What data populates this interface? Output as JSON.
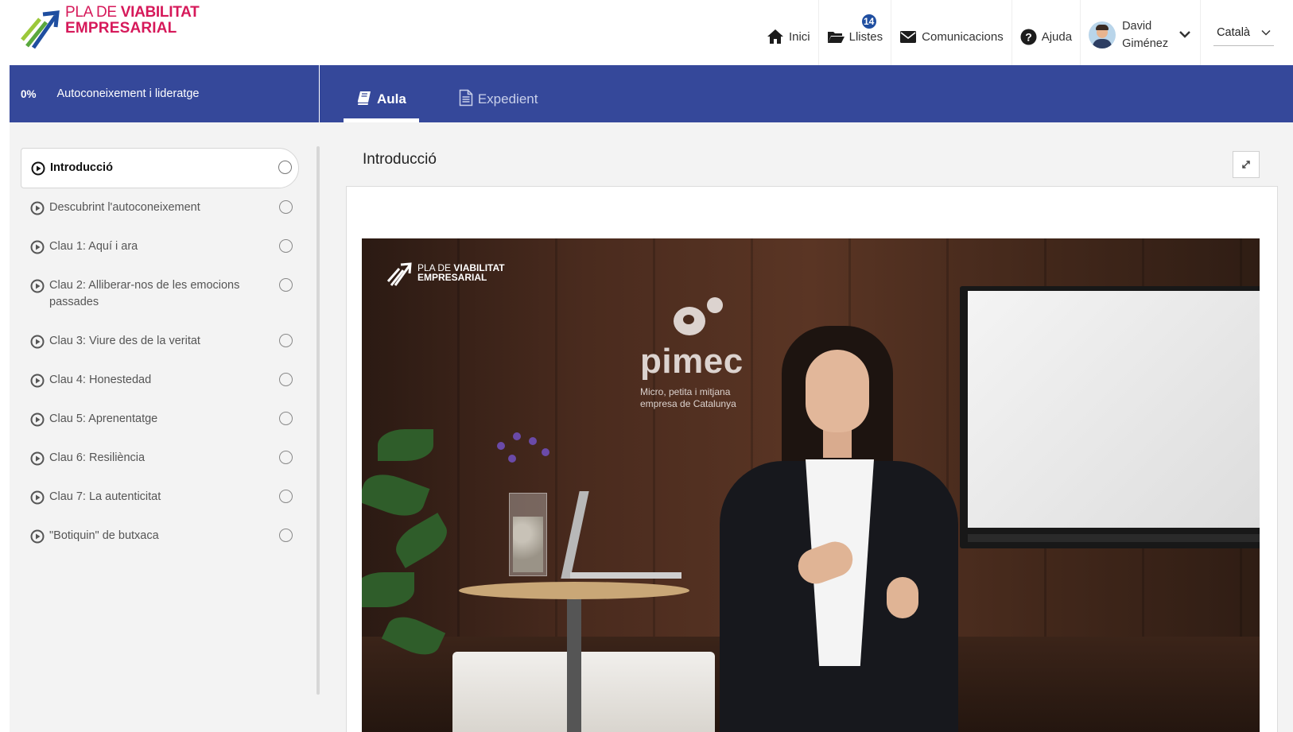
{
  "header": {
    "logo": {
      "line1_prefix": "PLA DE",
      "line1_bold": "VIABILITAT",
      "line2": "EMPRESARIAL"
    },
    "nav": [
      {
        "label": "Inici",
        "icon": "home-icon"
      },
      {
        "label": "Llistes",
        "icon": "folder-icon",
        "badge": "14"
      },
      {
        "label": "Comunicacions",
        "icon": "envelope-icon"
      },
      {
        "label": "Ajuda",
        "icon": "question-circle-icon"
      }
    ],
    "user": {
      "first_name": "David",
      "last_name": "Giménez"
    },
    "language": "Català"
  },
  "course_bar": {
    "progress": "0%",
    "course_title": "Autoconeixement i lideratge",
    "tabs": [
      {
        "label": "Aula",
        "icon": "book-icon",
        "active": true
      },
      {
        "label": "Expedient",
        "icon": "document-icon",
        "active": false
      }
    ]
  },
  "sidebar": {
    "lessons": [
      {
        "label": "Introducció",
        "active": true
      },
      {
        "label": "Descubrint l'autoconeixement"
      },
      {
        "label": "Clau 1: Aquí i ara"
      },
      {
        "label": "Clau 2: Alliberar-nos de les emocions passades"
      },
      {
        "label": "Clau 3: Viure des de la veritat"
      },
      {
        "label": "Clau 4: Honestedad"
      },
      {
        "label": "Clau 5: Aprenentatge"
      },
      {
        "label": "Clau 6: Resiliència"
      },
      {
        "label": "Clau 7: La autenticitat"
      },
      {
        "label": "\"Botiquin\" de butxaca"
      }
    ]
  },
  "content": {
    "title": "Introducció",
    "video": {
      "logo_prefix": "PLA DE",
      "logo_bold": "VIABILITAT",
      "logo_line2": "EMPRESARIAL",
      "pimec": "pimec",
      "pimec_sub1": "Micro, petita i mitjana",
      "pimec_sub2": "empresa de Catalunya"
    }
  },
  "colors": {
    "brand": "#d6195a",
    "navy": "#35489a",
    "badge": "#1f4ea0"
  }
}
